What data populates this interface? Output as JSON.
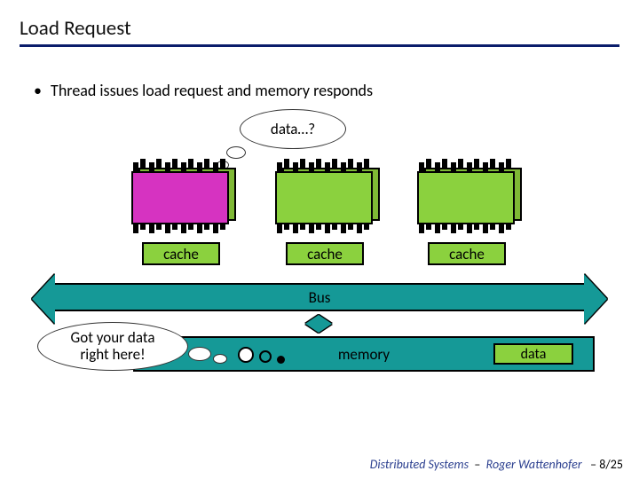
{
  "title": "Load Request",
  "bullet": "Thread issues load request and memory responds",
  "cloud_question": "data…?",
  "cloud_reply_line1": "Got your data",
  "cloud_reply_line2": "right here!",
  "cache_label": "cache",
  "bus_label": "Bus",
  "memory_label": "memory",
  "data_label": "data",
  "footer_course": "Distributed Systems",
  "footer_author": "Roger Wattenhofer",
  "footer_page": "8/25",
  "colors": {
    "accent_line": "#0a1d6b",
    "chip_back": "#7fb935",
    "chip_front_active": "#d633c1",
    "chip_front_idle": "#8bd13e",
    "cache": "#8bd13e",
    "bus": "#159997"
  }
}
